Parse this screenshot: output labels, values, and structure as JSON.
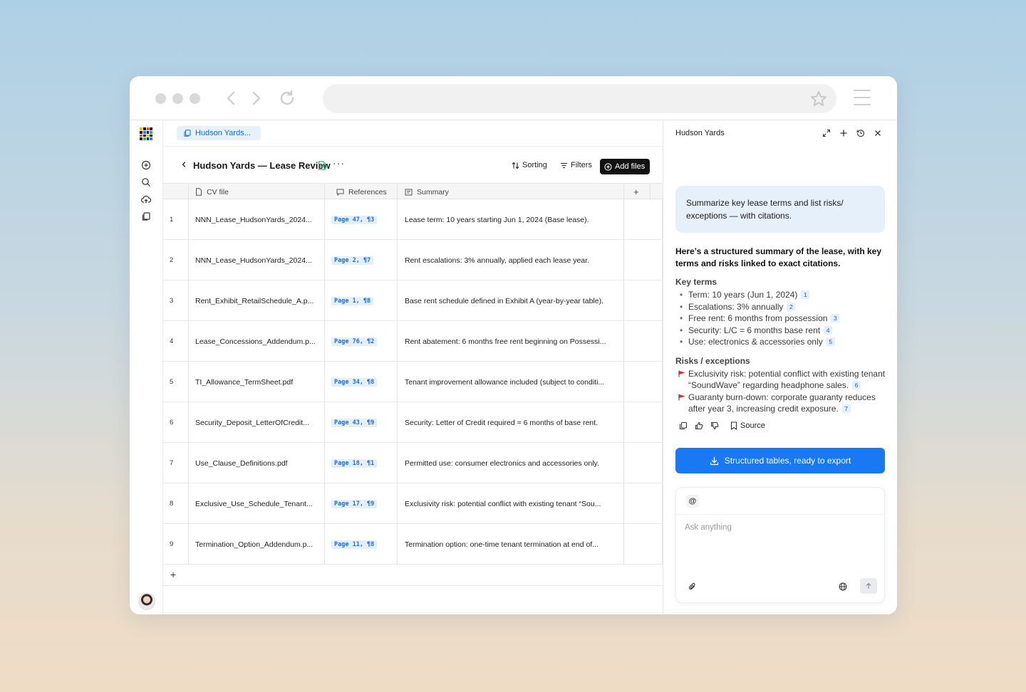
{
  "workspace": {
    "tab_label": "Hudson Yards...",
    "title": "Hudson Yards — Lease Review",
    "more_label": "···",
    "sorting_label": "Sorting",
    "filters_label": "Filters",
    "add_files_label": "Add files"
  },
  "table": {
    "columns": [
      "CV file",
      "References",
      "Summary"
    ],
    "add_column_label": "+",
    "add_row_label": "+",
    "rows": [
      {
        "num": "1",
        "file": "NNN_Lease_HudsonYards_2024...",
        "ref": "Page 47, ¶3",
        "summary": "Lease term: 10 years starting Jun 1, 2024 (Base lease)."
      },
      {
        "num": "2",
        "file": "NNN_Lease_HudsonYards_2024...",
        "ref": "Page 2, ¶7",
        "summary": "Rent escalations: 3% annually, applied each lease year."
      },
      {
        "num": "3",
        "file": "Rent_Exhibit_RetailSchedule_A.p...",
        "ref": "Page 1, ¶8",
        "summary": "Base rent schedule defined in Exhibit A (year-by-year table)."
      },
      {
        "num": "4",
        "file": "Lease_Concessions_Addendum.p...",
        "ref": "Page 76, ¶2",
        "summary": "Rent abatement: 6 months free rent beginning on Possessi..."
      },
      {
        "num": "5",
        "file": "TI_Allowance_TermSheet.pdf",
        "ref": "Page 34, ¶8",
        "summary": "Tenant improvement allowance included (subject to conditi..."
      },
      {
        "num": "6",
        "file": "Security_Deposit_LetterOfCredit...",
        "ref": "Page 43, ¶9",
        "summary": "Security: Letter of Credit required = 6 months of base rent."
      },
      {
        "num": "7",
        "file": "Use_Clause_Definitions.pdf",
        "ref": "Page 18, ¶1",
        "summary": "Permitted use: consumer electronics and accessories only."
      },
      {
        "num": "8",
        "file": "Exclusive_Use_Schedule_Tenant...",
        "ref": "Page 17, ¶9",
        "summary": "Exclusivity risk: potential conflict with existing tenant “Sou..."
      },
      {
        "num": "9",
        "file": "Termination_Option_Addendum.p...",
        "ref": "Page 11, ¶8",
        "summary": "Termination option: one-time tenant termination at end of..."
      }
    ]
  },
  "panel": {
    "title": "Hudson Yards",
    "prompt": "Summarize key lease terms and list risks/ exceptions — with citations.",
    "lead": "Here’s a structured summary of the lease, with key terms and risks linked to exact citations.",
    "key_terms_heading": "Key terms",
    "key_terms": [
      {
        "text": "Term: 10 years (Jun 1, 2024)",
        "cite": "1"
      },
      {
        "text": "Escalations: 3% annually",
        "cite": "2"
      },
      {
        "text": "Free rent: 6 months from possession",
        "cite": "3"
      },
      {
        "text": "Security: L/C = 6 months base rent",
        "cite": "4"
      },
      {
        "text": "Use: electronics & accessories only",
        "cite": "5"
      }
    ],
    "risks_heading": "Risks / exceptions",
    "risks": [
      {
        "text": "Exclusivity risk: potential conflict with existing tenant “SoundWave” regarding headphone sales.",
        "cite": "6"
      },
      {
        "text": "Guaranty burn-down: corporate guaranty reduces after year 3, increasing credit exposure.",
        "cite": "7"
      }
    ],
    "source_label": "Source",
    "export_label": "Structured tables, ready to export",
    "composer_mention": "@",
    "composer_placeholder": "Ask anything"
  },
  "colors": {
    "accent": "#1879f2",
    "citation_bg": "#e3effc",
    "risk_flag": "#d93025"
  }
}
